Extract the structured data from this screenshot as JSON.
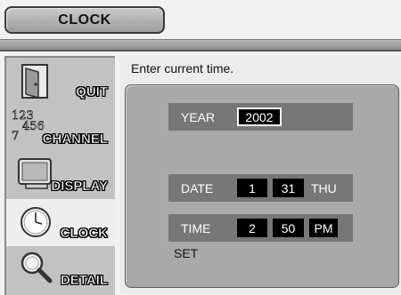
{
  "header": {
    "title": "CLOCK"
  },
  "sidebar": {
    "items": [
      {
        "label": "QUIT",
        "icon": "door-icon",
        "selected": false
      },
      {
        "label": "CHANNEL",
        "icon": "channel-numbers-icon",
        "icon_text": "123456 7",
        "selected": false
      },
      {
        "label": "DISPLAY",
        "icon": "monitor-icon",
        "selected": false
      },
      {
        "label": "CLOCK",
        "icon": "clock-icon",
        "selected": true
      },
      {
        "label": "DETAIL",
        "icon": "magnifier-icon",
        "selected": false
      }
    ]
  },
  "main": {
    "instruction": "Enter current time.",
    "year": {
      "label": "YEAR",
      "value": "2002"
    },
    "date": {
      "label": "DATE",
      "month": "1",
      "day": "31",
      "weekday": "THU"
    },
    "time": {
      "label": "TIME",
      "hour": "2",
      "minute": "50",
      "ampm": "PM"
    },
    "set_label": "SET"
  },
  "colors": {
    "background": "#f1f1f1",
    "sidebar": "#c2c2c2",
    "panel": "#a9a9a9",
    "row": "#777777",
    "value_box": "#000000"
  }
}
